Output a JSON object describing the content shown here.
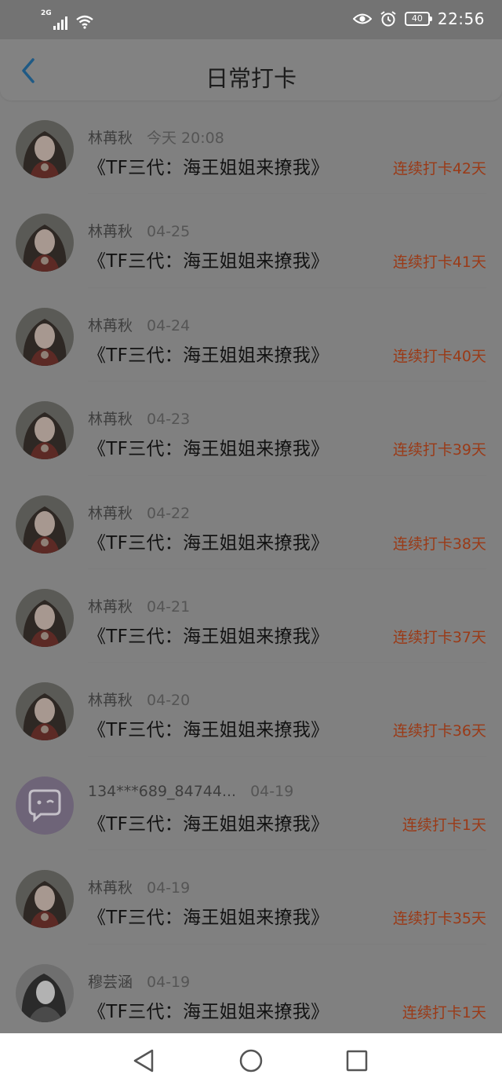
{
  "status_bar": {
    "network": "2G",
    "battery": "40",
    "time": "22:56"
  },
  "header": {
    "title": "日常打卡"
  },
  "rows": [
    {
      "name": "林苒秋",
      "date": "今天 20:08",
      "title": "《TF三代：海王姐姐来撩我》",
      "streak": "连续打卡42天",
      "avatar": "girl-photo"
    },
    {
      "name": "林苒秋",
      "date": "04-25",
      "title": "《TF三代：海王姐姐来撩我》",
      "streak": "连续打卡41天",
      "avatar": "girl-photo"
    },
    {
      "name": "林苒秋",
      "date": "04-24",
      "title": "《TF三代：海王姐姐来撩我》",
      "streak": "连续打卡40天",
      "avatar": "girl-photo"
    },
    {
      "name": "林苒秋",
      "date": "04-23",
      "title": "《TF三代：海王姐姐来撩我》",
      "streak": "连续打卡39天",
      "avatar": "girl-photo"
    },
    {
      "name": "林苒秋",
      "date": "04-22",
      "title": "《TF三代：海王姐姐来撩我》",
      "streak": "连续打卡38天",
      "avatar": "girl-photo"
    },
    {
      "name": "林苒秋",
      "date": "04-21",
      "title": "《TF三代：海王姐姐来撩我》",
      "streak": "连续打卡37天",
      "avatar": "girl-photo"
    },
    {
      "name": "林苒秋",
      "date": "04-20",
      "title": "《TF三代：海王姐姐来撩我》",
      "streak": "连续打卡36天",
      "avatar": "girl-photo"
    },
    {
      "name": "134***689_84744...",
      "date": "04-19",
      "title": "《TF三代：海王姐姐来撩我》",
      "streak": "连续打卡1天",
      "avatar": "default-chat"
    },
    {
      "name": "林苒秋",
      "date": "04-19",
      "title": "《TF三代：海王姐姐来撩我》",
      "streak": "连续打卡35天",
      "avatar": "girl-photo"
    },
    {
      "name": "穆芸涵",
      "date": "04-19",
      "title": "《TF三代：海王姐姐来撩我》",
      "streak": "连续打卡1天",
      "avatar": "bw-photo"
    }
  ],
  "colors": {
    "accent_back": "#1f5a85",
    "streak": "#9a3a17",
    "overlay": "#808080"
  },
  "icons": {
    "back": "chevron-left-icon",
    "nav_back": "triangle-back-icon",
    "nav_home": "circle-home-icon",
    "nav_recent": "square-recent-icon"
  }
}
